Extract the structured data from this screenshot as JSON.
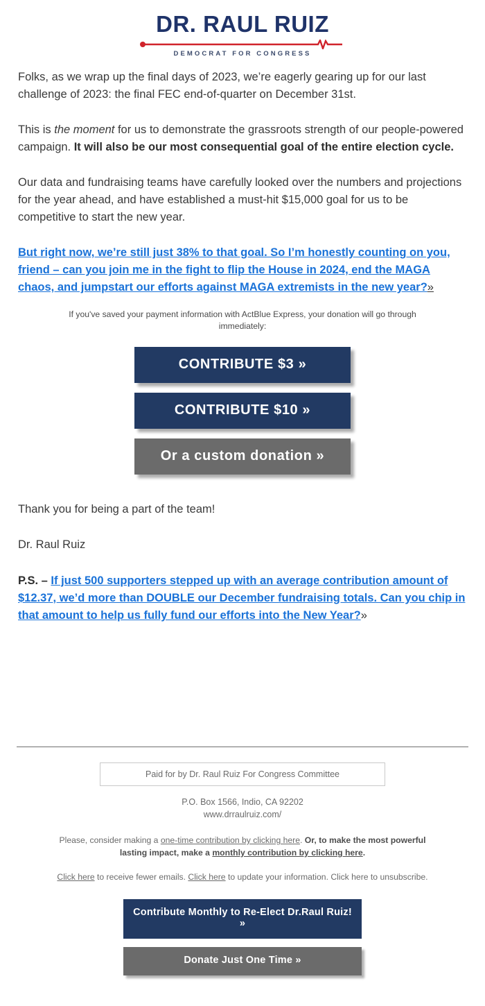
{
  "brand": {
    "navy": "#223a63",
    "gray": "#6b6b6b",
    "link_blue": "#1a72d8",
    "accent_red": "#d0232b"
  },
  "header": {
    "logo_name": "DR. RAUL RUIZ",
    "logo_tagline": "DEMOCRAT FOR CONGRESS"
  },
  "body": {
    "para1": "Folks, as we wrap up the final days of 2023, we’re eagerly gearing up for our last challenge of 2023: the final FEC end-of-quarter on December 31st.",
    "para2_pre": "This is ",
    "para2_em": "the moment",
    "para2_mid": " for us to demonstrate the grassroots strength of our people-powered campaign. ",
    "para2_bold": "It will also be our most consequential goal of the entire election cycle.",
    "para3": "Our data and fundraising teams have carefully looked over the numbers and projections for the year ahead, and have established a must-hit $15,000 goal for us to be competitive to start the new year.",
    "link_para": "But right now, we’re still just 38% to that goal. So I’m honestly counting on you, friend – can you join me in the fight to flip the House in 2024, end the MAGA chaos, and jumpstart our efforts against MAGA extremists in the new year?",
    "link_chevron": "»",
    "express_note": "If you've saved your payment information with ActBlue Express, your donation will go through immediately:",
    "thank_you": "Thank you for being a part of the team!",
    "signature": "Dr. Raul Ruiz",
    "ps_label": "P.S. –",
    "ps_link": "If just 500 supporters stepped up with an average contribution amount of $12.37, we’d more than DOUBLE our December fundraising totals. Can you chip in that amount to help us fully fund our efforts into the New Year?",
    "ps_chevron": "»"
  },
  "cta_buttons": [
    {
      "label": "CONTRIBUTE $3 »",
      "style": "navy"
    },
    {
      "label": "CONTRIBUTE $10 »",
      "style": "navy"
    },
    {
      "label": "Or a custom donation »",
      "style": "gray"
    }
  ],
  "footer": {
    "paid_for": "Paid for by Dr. Raul Ruiz For Congress Committee",
    "address": "P.O. Box 1566, Indio, CA 92202",
    "website": "www.drraulruiz.com/",
    "consider_pre": "Please, consider making a ",
    "consider_link1": "one-time contribution by clicking here",
    "consider_mid": ". ",
    "consider_bold": "Or, to make the most powerful lasting impact, make a ",
    "consider_link2": "monthly contribution by clicking here",
    "consider_end": ".",
    "manage_link1": "Click here",
    "manage_mid1": " to receive fewer emails. ",
    "manage_link2": "Click here",
    "manage_mid2": " to update your information. Click here to unsubscribe.",
    "buttons": [
      {
        "label": "Contribute Monthly to Re-Elect Dr.Raul Ruiz! »",
        "style": "navy"
      },
      {
        "label": "Donate Just One Time »",
        "style": "gray"
      }
    ]
  }
}
